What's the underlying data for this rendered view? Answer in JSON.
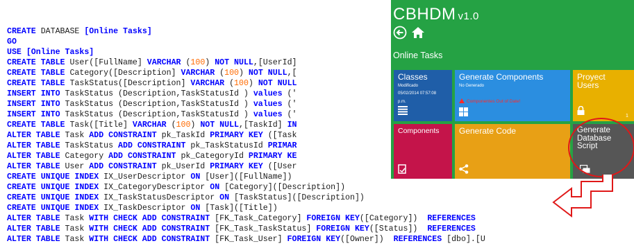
{
  "code_lines": [
    [
      [
        "kw",
        "CREATE"
      ],
      [
        "id",
        " DATABASE "
      ],
      [
        "str",
        "[Online Tasks]"
      ]
    ],
    [
      [
        "kw",
        "GO"
      ]
    ],
    [
      [
        "kw",
        "USE"
      ],
      [
        "id",
        " "
      ],
      [
        "str",
        "[Online Tasks]"
      ]
    ],
    [
      [
        "kw",
        "CREATE TABLE"
      ],
      [
        "id",
        " User([FullName] "
      ],
      [
        "kw",
        "VARCHAR"
      ],
      [
        "id",
        " ("
      ],
      [
        "num",
        "100"
      ],
      [
        "id",
        ") "
      ],
      [
        "kw",
        "NOT NULL"
      ],
      [
        "id",
        ",[UserId]"
      ]
    ],
    [
      [
        "kw",
        "CREATE TABLE"
      ],
      [
        "id",
        " Category([Description] "
      ],
      [
        "kw",
        "VARCHAR"
      ],
      [
        "id",
        " ("
      ],
      [
        "num",
        "100"
      ],
      [
        "id",
        ") "
      ],
      [
        "kw",
        "NOT NULL"
      ],
      [
        "id",
        ",["
      ]
    ],
    [
      [
        "kw",
        "CREATE TABLE"
      ],
      [
        "id",
        " TaskStatus([Description] "
      ],
      [
        "kw",
        "VARCHAR"
      ],
      [
        "id",
        " ("
      ],
      [
        "num",
        "100"
      ],
      [
        "id",
        ") "
      ],
      [
        "kw",
        "NOT NULL"
      ]
    ],
    [
      [
        "kw",
        "INSERT INTO"
      ],
      [
        "id",
        " TaskStatus (Description,TaskStatusId ) "
      ],
      [
        "kw",
        "values"
      ],
      [
        "id",
        " ('"
      ]
    ],
    [
      [
        "kw",
        "INSERT INTO"
      ],
      [
        "id",
        " TaskStatus (Description,TaskStatusId ) "
      ],
      [
        "kw",
        "values"
      ],
      [
        "id",
        " ('"
      ]
    ],
    [
      [
        "kw",
        "INSERT INTO"
      ],
      [
        "id",
        " TaskStatus (Description,TaskStatusId ) "
      ],
      [
        "kw",
        "values"
      ],
      [
        "id",
        " ('"
      ]
    ],
    [
      [
        "kw",
        "CREATE TABLE"
      ],
      [
        "id",
        " Task([Title] "
      ],
      [
        "kw",
        "VARCHAR"
      ],
      [
        "id",
        " ("
      ],
      [
        "num",
        "100"
      ],
      [
        "id",
        ") "
      ],
      [
        "kw",
        "NOT NULL"
      ],
      [
        "id",
        ",[TaskId] "
      ],
      [
        "kw",
        "IN"
      ]
    ],
    [
      [
        "kw",
        "ALTER TABLE"
      ],
      [
        "id",
        " Task "
      ],
      [
        "kw",
        "ADD CONSTRAINT"
      ],
      [
        "id",
        " pk_TaskId "
      ],
      [
        "kw",
        "PRIMARY KEY"
      ],
      [
        "id",
        " ([Task"
      ]
    ],
    [
      [
        "kw",
        "ALTER TABLE"
      ],
      [
        "id",
        " TaskStatus "
      ],
      [
        "kw",
        "ADD CONSTRAINT"
      ],
      [
        "id",
        " pk_TaskStatusId "
      ],
      [
        "kw",
        "PRIMAR"
      ]
    ],
    [
      [
        "kw",
        "ALTER TABLE"
      ],
      [
        "id",
        " Category "
      ],
      [
        "kw",
        "ADD CONSTRAINT"
      ],
      [
        "id",
        " pk_CategoryId "
      ],
      [
        "kw",
        "PRIMARY KE"
      ]
    ],
    [
      [
        "kw",
        "ALTER TABLE"
      ],
      [
        "id",
        " User "
      ],
      [
        "kw",
        "ADD CONSTRAINT"
      ],
      [
        "id",
        " pk_UserId "
      ],
      [
        "kw",
        "PRIMARY KEY"
      ],
      [
        "id",
        " ([User"
      ]
    ],
    [
      [
        "kw",
        "CREATE UNIQUE INDEX"
      ],
      [
        "id",
        " IX_UserDescriptor "
      ],
      [
        "kw",
        "ON"
      ],
      [
        "id",
        " [User]([FullName])"
      ]
    ],
    [
      [
        "kw",
        "CREATE UNIQUE INDEX"
      ],
      [
        "id",
        " IX_CategoryDescriptor "
      ],
      [
        "kw",
        "ON"
      ],
      [
        "id",
        " [Category]([Description])"
      ]
    ],
    [
      [
        "kw",
        "CREATE UNIQUE INDEX"
      ],
      [
        "id",
        " IX_TaskStatusDescriptor "
      ],
      [
        "kw",
        "ON"
      ],
      [
        "id",
        " [TaskStatus]([Description])"
      ]
    ],
    [
      [
        "kw",
        "CREATE UNIQUE INDEX"
      ],
      [
        "id",
        " IX_TaskDescriptor "
      ],
      [
        "kw",
        "ON"
      ],
      [
        "id",
        " [Task]([Title])"
      ]
    ],
    [
      [
        "kw",
        "ALTER TABLE"
      ],
      [
        "id",
        " Task "
      ],
      [
        "kw",
        "WITH CHECK ADD CONSTRAINT"
      ],
      [
        "id",
        " [FK_Task_Category] "
      ],
      [
        "kw",
        "FOREIGN KEY"
      ],
      [
        "id",
        "([Category])  "
      ],
      [
        "ref",
        "REFERENCES"
      ]
    ],
    [
      [
        "kw",
        "ALTER TABLE"
      ],
      [
        "id",
        " Task "
      ],
      [
        "kw",
        "WITH CHECK ADD CONSTRAINT"
      ],
      [
        "id",
        " [FK_Task_TaskStatus] "
      ],
      [
        "kw",
        "FOREIGN KEY"
      ],
      [
        "id",
        "([Status])  "
      ],
      [
        "ref",
        "REFERENCES"
      ]
    ],
    [
      [
        "kw",
        "ALTER TABLE"
      ],
      [
        "id",
        " Task "
      ],
      [
        "kw",
        "WITH CHECK ADD CONSTRAINT"
      ],
      [
        "id",
        " [FK_Task_User] "
      ],
      [
        "kw",
        "FOREIGN KEY"
      ],
      [
        "id",
        "([Owner])  "
      ],
      [
        "ref",
        "REFERENCES"
      ],
      [
        "id",
        " [dbo].[U"
      ]
    ]
  ],
  "app": {
    "title": "CBHDM",
    "version": "v1.0",
    "subtitle": "Online Tasks"
  },
  "tiles": {
    "classes": {
      "label": "Classes",
      "line1": "Modificado",
      "line2": "05/02/2014 07:57:08",
      "line3": "p.m.",
      "color": "#1f5ea8",
      "icon": "list-icon"
    },
    "generate_components": {
      "label": "Generate Components",
      "line1": "No Generado",
      "warning": "Componentes Out of Date!",
      "color": "#2b8ee0",
      "icon": "grid-icon"
    },
    "proyect_users": {
      "label": "Proyect Users",
      "badge": "1",
      "color": "#e8b000",
      "icon": "lock-icon"
    },
    "components": {
      "label": "Components",
      "color": "#c4144a",
      "icon": "document-icon"
    },
    "generate_code": {
      "label": "Generate Code",
      "color": "#e8a015",
      "icon": "share-icon"
    },
    "generate_db_script": {
      "label": "Generate Database Script",
      "color": "#565656",
      "icon": "database-icon"
    }
  },
  "colors": {
    "panel": "#25a244",
    "annotation": "#e01818"
  }
}
